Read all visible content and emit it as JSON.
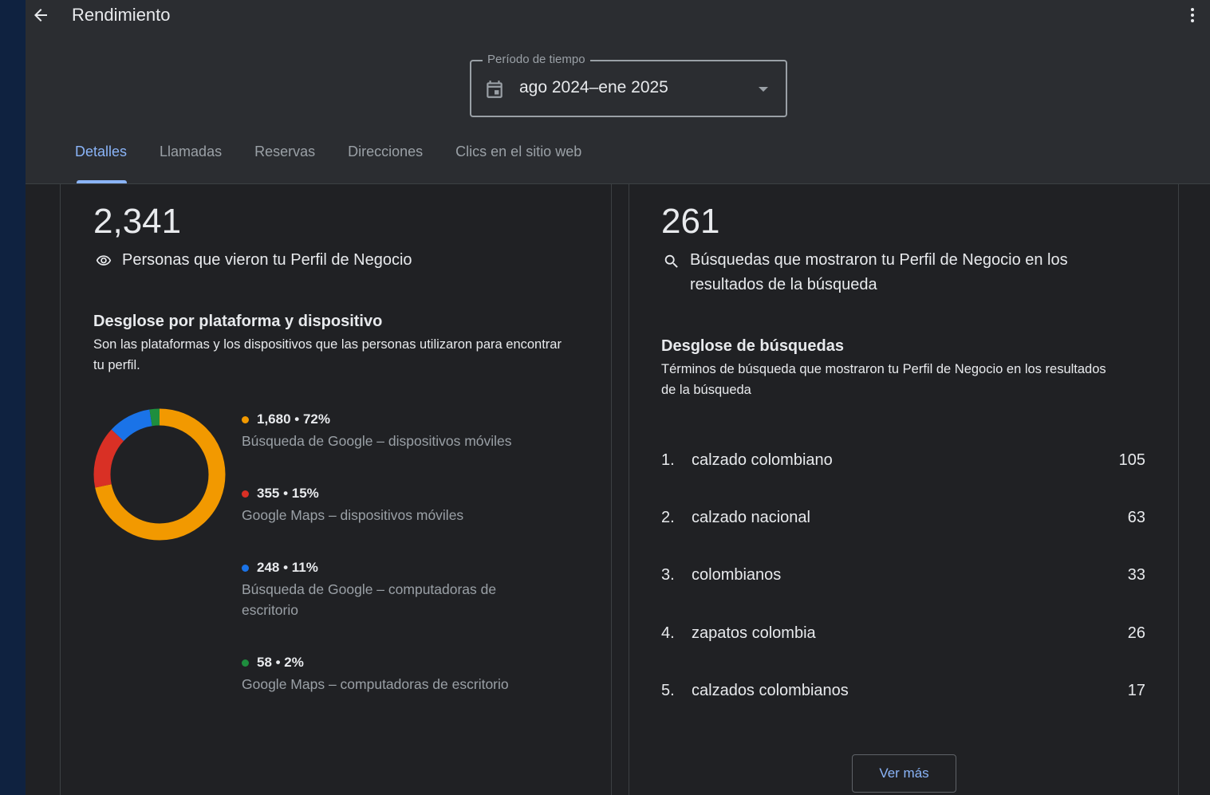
{
  "header": {
    "title": "Rendimiento",
    "period_label": "Período de tiempo",
    "period_value": "ago 2024–ene 2025"
  },
  "tabs": [
    {
      "label": "Detalles",
      "active": true
    },
    {
      "label": "Llamadas",
      "active": false
    },
    {
      "label": "Reservas",
      "active": false
    },
    {
      "label": "Direcciones",
      "active": false
    },
    {
      "label": "Clics en el sitio web",
      "active": false
    }
  ],
  "left_card": {
    "total": "2,341",
    "total_label": "Personas que vieron tu Perfil de Negocio",
    "section_title": "Desglose por plataforma y dispositivo",
    "section_desc": "Son las plataformas y los dispositivos que las personas utilizaron para encontrar tu perfil.",
    "breakdown": [
      {
        "value": "1,680 • 72%",
        "label": "Búsqueda de Google – dispositivos móviles",
        "count": 1680,
        "color": "#f29900"
      },
      {
        "value": "355 • 15%",
        "label": "Google Maps – dispositivos móviles",
        "count": 355,
        "color": "#d93025"
      },
      {
        "value": "248 • 11%",
        "label": "Búsqueda de Google – computadoras de escritorio",
        "count": 248,
        "color": "#1a73e8"
      },
      {
        "value": "58 • 2%",
        "label": "Google Maps – computadoras de escritorio",
        "count": 58,
        "color": "#1e8e3e"
      }
    ]
  },
  "right_card": {
    "total": "261",
    "total_label": "Búsquedas que mostraron tu Perfil de Negocio en los resultados de la búsqueda",
    "section_title": "Desglose de búsquedas",
    "section_desc": "Términos de búsqueda que mostraron tu Perfil de Negocio en los resultados de la búsqueda",
    "searches": [
      {
        "rank": "1.",
        "term": "calzado colombiano",
        "count": "105"
      },
      {
        "rank": "2.",
        "term": "calzado nacional",
        "count": "63"
      },
      {
        "rank": "3.",
        "term": "colombianos",
        "count": "33"
      },
      {
        "rank": "4.",
        "term": "zapatos colombia",
        "count": "26"
      },
      {
        "rank": "5.",
        "term": "calzados colombianos",
        "count": "17"
      }
    ],
    "more_label": "Ver más"
  },
  "icons": {
    "back": "arrow-back-icon",
    "more": "more-vert-icon",
    "calendar": "calendar-icon",
    "dropdown": "dropdown-arrow-icon",
    "eye": "eye-icon",
    "search": "search-icon"
  }
}
